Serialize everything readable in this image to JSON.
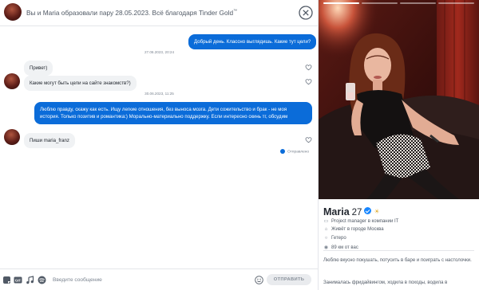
{
  "header": {
    "title": "Вы и Maria образовали пару 28.05.2023. Всё благодаря Tinder Gold",
    "title_mark": "™"
  },
  "messages": [
    {
      "direction": "out",
      "text": "Добрый день. Классно выглядишь. Какие тут цели?"
    },
    {
      "type": "timestamp",
      "text": "27.06.2023, 20:24"
    },
    {
      "direction": "in",
      "text": "Привет)"
    },
    {
      "direction": "in",
      "text": "Какие могут быть цели на сайте знакомств?)"
    },
    {
      "type": "timestamp",
      "text": "30.06.2023, 11:25"
    },
    {
      "direction": "out",
      "text": "Люблю правду, скажу как есть. Ищу легкие отношения, без выноса мозга. Дети сожительство и брак - не моя история. Только позитив и романтика:) Морально-материально поддержку. Если интересно скинь тг, обсудим"
    },
    {
      "type": "status",
      "text": "Отправлено"
    },
    {
      "direction": "in",
      "text": "Пиши maria_franz"
    }
  ],
  "composer": {
    "placeholder": "Введите сообщение",
    "value": "",
    "send_label": "ОТПРАВИТЬ",
    "icons": [
      "sticker-icon",
      "gif-icon",
      "music-icon",
      "spotify-icon",
      "emoji-icon"
    ]
  },
  "profile": {
    "photo_count": 4,
    "active_photo": 1,
    "name": "Maria",
    "age": "27",
    "details": [
      {
        "icon": "briefcase-icon",
        "text": "Project manager в компании IT"
      },
      {
        "icon": "home-icon",
        "text": "Живёт в городе Москва"
      },
      {
        "icon": "person-icon",
        "text": "Гетеро"
      },
      {
        "icon": "location-icon",
        "text": "89 км от вас"
      }
    ],
    "bio_1": "Люблю вкусно покушать, потусить в баре и поиграть с настолочки.",
    "bio_2": "Занималась фридайвингом, ходила в походы, водила в"
  },
  "colors": {
    "accent_blue": "#0b6cd9",
    "incoming_bubble": "#f0f2f4",
    "verified_blue": "#1786ff"
  }
}
